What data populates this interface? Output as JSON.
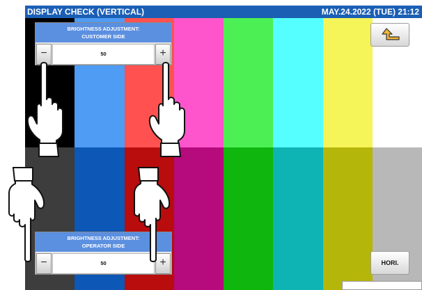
{
  "header": {
    "title": "DISPLAY CHECK (VERTICAL)",
    "datetime": "MAY.24.2022 (TUE) 21:12"
  },
  "colors": {
    "header_bg": "#1b5fb5",
    "panel_title_bg": "#5b8fe0",
    "top_bars": [
      "#000000",
      "#4f9cf4",
      "#ff5250",
      "#ff55cc",
      "#4df054",
      "#55ffff",
      "#f5f55a",
      "#ffffff"
    ],
    "bottom_bars": [
      "#3d3d3d",
      "#0d57b6",
      "#b80c0d",
      "#b50b7c",
      "#0eb60d",
      "#0eb3b4",
      "#b5b60a",
      "#b8b8b8"
    ]
  },
  "customer_panel": {
    "title": "BRIGHTNESS ADJUSTMENT:\nCUSTOMER SIDE",
    "value": "50",
    "minus_label": "−",
    "plus_label": "+"
  },
  "operator_panel": {
    "title": "BRIGHTNESS ADJUSTMENT:\nOPERATOR SIDE",
    "value": "50",
    "minus_label": "−",
    "plus_label": "+"
  },
  "buttons": {
    "return_icon": "return-arrow-icon",
    "hori_label": "HORI."
  }
}
